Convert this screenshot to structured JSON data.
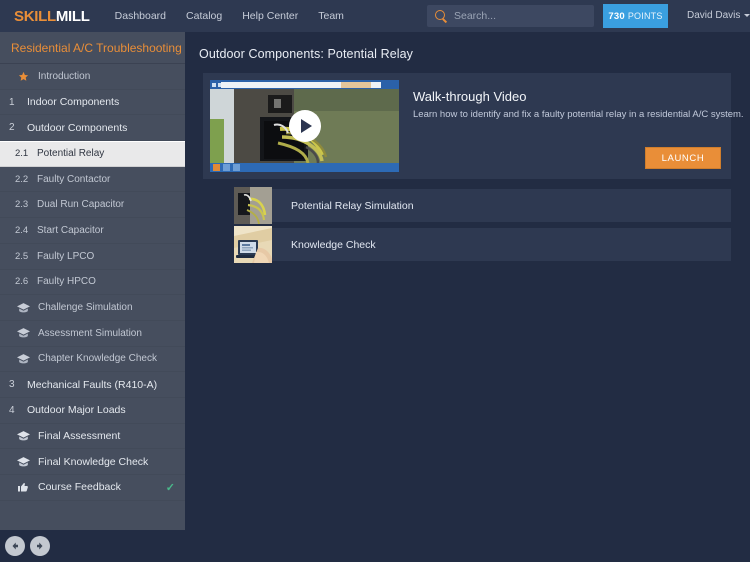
{
  "header": {
    "brand_first": "SKILL",
    "brand_second": "MILL",
    "nav": [
      {
        "label": "Dashboard"
      },
      {
        "label": "Catalog"
      },
      {
        "label": "Help Center"
      },
      {
        "label": "Team"
      }
    ],
    "search": {
      "placeholder": "Search...",
      "value": "",
      "icon": "search-icon"
    },
    "points": {
      "number": "730",
      "label": "POINTS",
      "color": "#3a9fe0"
    },
    "user": {
      "name": "David Davis",
      "caret": "chevron-down-icon"
    }
  },
  "sidebar": {
    "course_title": "Residential A/C Troubleshooting",
    "title_color": "#e98e38",
    "items": [
      {
        "num": "",
        "label": "Introduction",
        "icon": "star-icon",
        "type": "starred",
        "active": false,
        "completed": false
      },
      {
        "num": "1",
        "label": "Indoor Components",
        "icon": "",
        "type": "chapter",
        "active": false,
        "completed": false
      },
      {
        "num": "2",
        "label": "Outdoor Components",
        "icon": "",
        "type": "chapter",
        "active": false,
        "completed": false
      },
      {
        "num": "2.1",
        "label": "Potential Relay",
        "icon": "",
        "type": "sub",
        "active": true,
        "completed": false
      },
      {
        "num": "2.2",
        "label": "Faulty Contactor",
        "icon": "",
        "type": "sub",
        "active": false,
        "completed": false
      },
      {
        "num": "2.3",
        "label": "Dual Run Capacitor",
        "icon": "",
        "type": "sub",
        "active": false,
        "completed": false
      },
      {
        "num": "2.4",
        "label": "Start Capacitor",
        "icon": "",
        "type": "sub",
        "active": false,
        "completed": false
      },
      {
        "num": "2.5",
        "label": "Faulty LPCO",
        "icon": "",
        "type": "sub",
        "active": false,
        "completed": false
      },
      {
        "num": "2.6",
        "label": "Faulty HPCO",
        "icon": "",
        "type": "sub",
        "active": false,
        "completed": false
      },
      {
        "num": "",
        "label": "Challenge Simulation",
        "icon": "graduation-cap-icon",
        "type": "leaf",
        "active": false,
        "completed": false
      },
      {
        "num": "",
        "label": "Assessment Simulation",
        "icon": "graduation-cap-icon",
        "type": "leaf",
        "active": false,
        "completed": false
      },
      {
        "num": "",
        "label": "Chapter Knowledge Check",
        "icon": "graduation-cap-icon",
        "type": "leaf",
        "active": false,
        "completed": false
      },
      {
        "num": "3",
        "label": "Mechanical Faults (R410-A)",
        "icon": "",
        "type": "chapter",
        "active": false,
        "completed": false
      },
      {
        "num": "4",
        "label": "Outdoor Major Loads",
        "icon": "",
        "type": "chapter",
        "active": false,
        "completed": false
      },
      {
        "num": "",
        "label": "Final Assessment",
        "icon": "graduation-cap-icon",
        "type": "major-icon",
        "active": false,
        "completed": false
      },
      {
        "num": "",
        "label": "Final Knowledge Check",
        "icon": "graduation-cap-icon",
        "type": "major-icon",
        "active": false,
        "completed": false
      },
      {
        "num": "",
        "label": "Course Feedback",
        "icon": "thumbs-up-icon",
        "type": "major-icon",
        "active": false,
        "completed": true
      }
    ],
    "completed_check": "✓",
    "completed_color": "#49b88a",
    "footer": {
      "back_label": "back-arrow",
      "forward_label": "forward-arrow"
    }
  },
  "main": {
    "page_title": "Outdoor Components: Potential Relay",
    "video_card": {
      "title": "Walk-through Video",
      "description": "Learn how to identify and fix a faulty potential relay in a residential A/C system.",
      "launch_label": "LAUNCH",
      "launch_color": "#e98e38",
      "play_icon": "play-icon"
    },
    "list_items": [
      {
        "label": "Potential Relay Simulation",
        "thumb": "relay-wiring-thumbnail"
      },
      {
        "label": "Knowledge Check",
        "thumb": "quiz-laptop-thumbnail"
      }
    ]
  }
}
